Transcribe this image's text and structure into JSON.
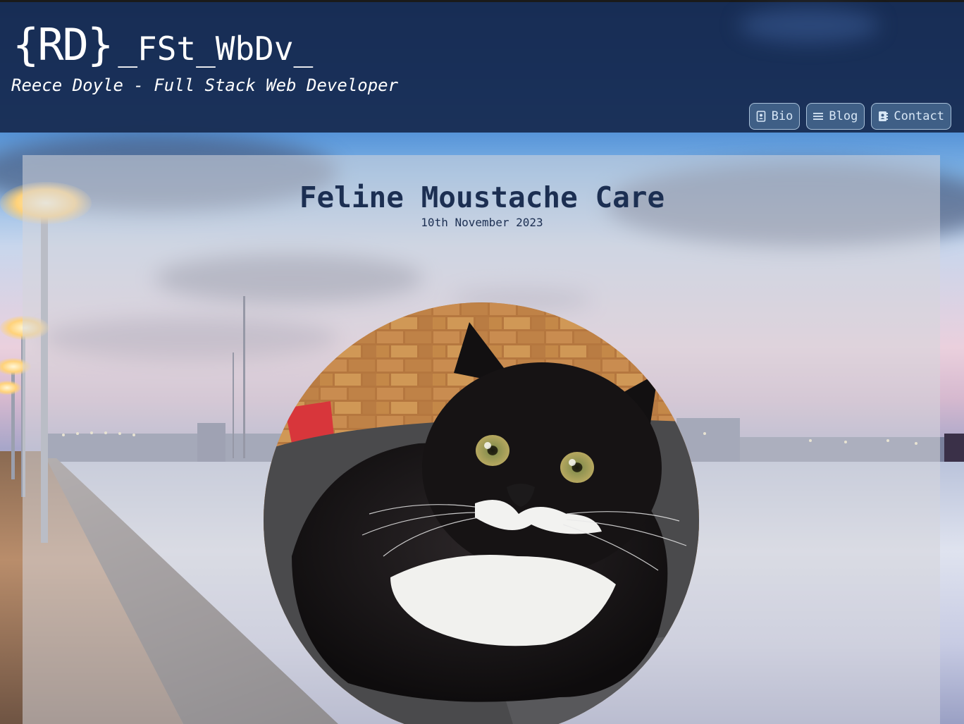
{
  "header": {
    "logo_braces": "{RD}",
    "logo_text": "_FSt_WbDv_",
    "tagline": "Reece Doyle - Full Stack Web Developer"
  },
  "nav": {
    "items": [
      {
        "label": "Bio",
        "icon": "id-badge-icon"
      },
      {
        "label": "Blog",
        "icon": "list-icon"
      },
      {
        "label": "Contact",
        "icon": "address-book-icon"
      }
    ]
  },
  "post": {
    "title": "Feline Moustache Care",
    "date": "10th November 2023",
    "image": "black-and-white-cat-photo"
  },
  "colors": {
    "header_bg": "#182c52",
    "title_text": "#1c2f52",
    "nav_button_bg": "#3f5f86",
    "nav_button_border": "#a8c0d8"
  }
}
